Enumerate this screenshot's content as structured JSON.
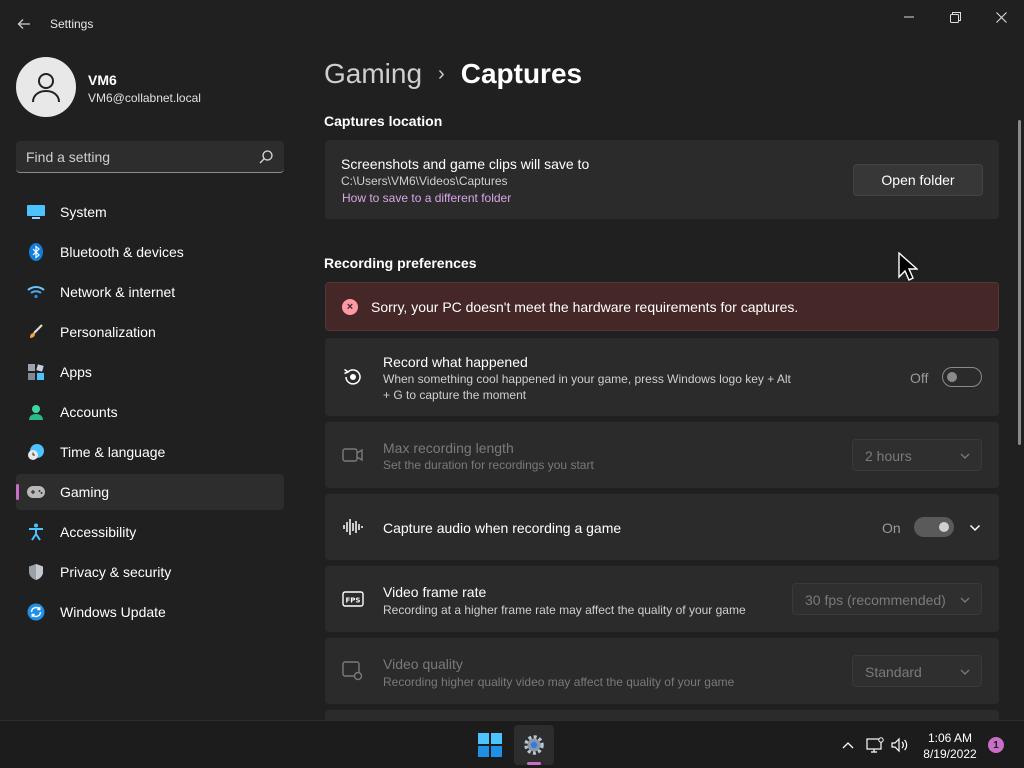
{
  "window": {
    "title": "Settings"
  },
  "user": {
    "name": "VM6",
    "email": "VM6@collabnet.local"
  },
  "search": {
    "placeholder": "Find a setting"
  },
  "sidebar": {
    "items": [
      {
        "label": "System",
        "icon": "system-icon"
      },
      {
        "label": "Bluetooth & devices",
        "icon": "bluetooth-icon"
      },
      {
        "label": "Network & internet",
        "icon": "wifi-icon"
      },
      {
        "label": "Personalization",
        "icon": "brush-icon"
      },
      {
        "label": "Apps",
        "icon": "apps-icon"
      },
      {
        "label": "Accounts",
        "icon": "person-icon"
      },
      {
        "label": "Time & language",
        "icon": "clock-globe-icon"
      },
      {
        "label": "Gaming",
        "icon": "gamepad-icon",
        "active": true
      },
      {
        "label": "Accessibility",
        "icon": "accessibility-icon"
      },
      {
        "label": "Privacy & security",
        "icon": "shield-icon"
      },
      {
        "label": "Windows Update",
        "icon": "update-icon"
      }
    ]
  },
  "breadcrumb": {
    "parent": "Gaming",
    "separator": "›",
    "current": "Captures"
  },
  "captures_location": {
    "section_title": "Captures location",
    "title": "Screenshots and game clips will save to",
    "path": "C:\\Users\\VM6\\Videos\\Captures",
    "link": "How to save to a different folder",
    "button": "Open folder"
  },
  "recording": {
    "section_title": "Recording preferences",
    "error": "Sorry, your PC doesn't meet the hardware requirements for captures.",
    "record_what_happened": {
      "title": "Record what happened",
      "desc_line1": "When something cool happened in your game, press Windows logo key + Alt",
      "desc_line2": "+ G to capture the moment",
      "state": "Off"
    },
    "max_length": {
      "title": "Max recording length",
      "desc": "Set the duration for recordings you start",
      "value": "2 hours"
    },
    "capture_audio": {
      "title": "Capture audio when recording a game",
      "state": "On"
    },
    "frame_rate": {
      "title": "Video frame rate",
      "desc": "Recording at a higher frame rate may affect the quality of your game",
      "value": "30 fps (recommended)"
    },
    "video_quality": {
      "title": "Video quality",
      "desc": "Recording higher quality video may affect the quality of your game",
      "value": "Standard"
    }
  },
  "taskbar": {
    "time": "1:06 AM",
    "date": "8/19/2022",
    "notifications": "1"
  },
  "colors": {
    "accent": "#c66fc5",
    "background": "#202020",
    "card": "#2b2b2b",
    "error_bg": "#442726"
  }
}
